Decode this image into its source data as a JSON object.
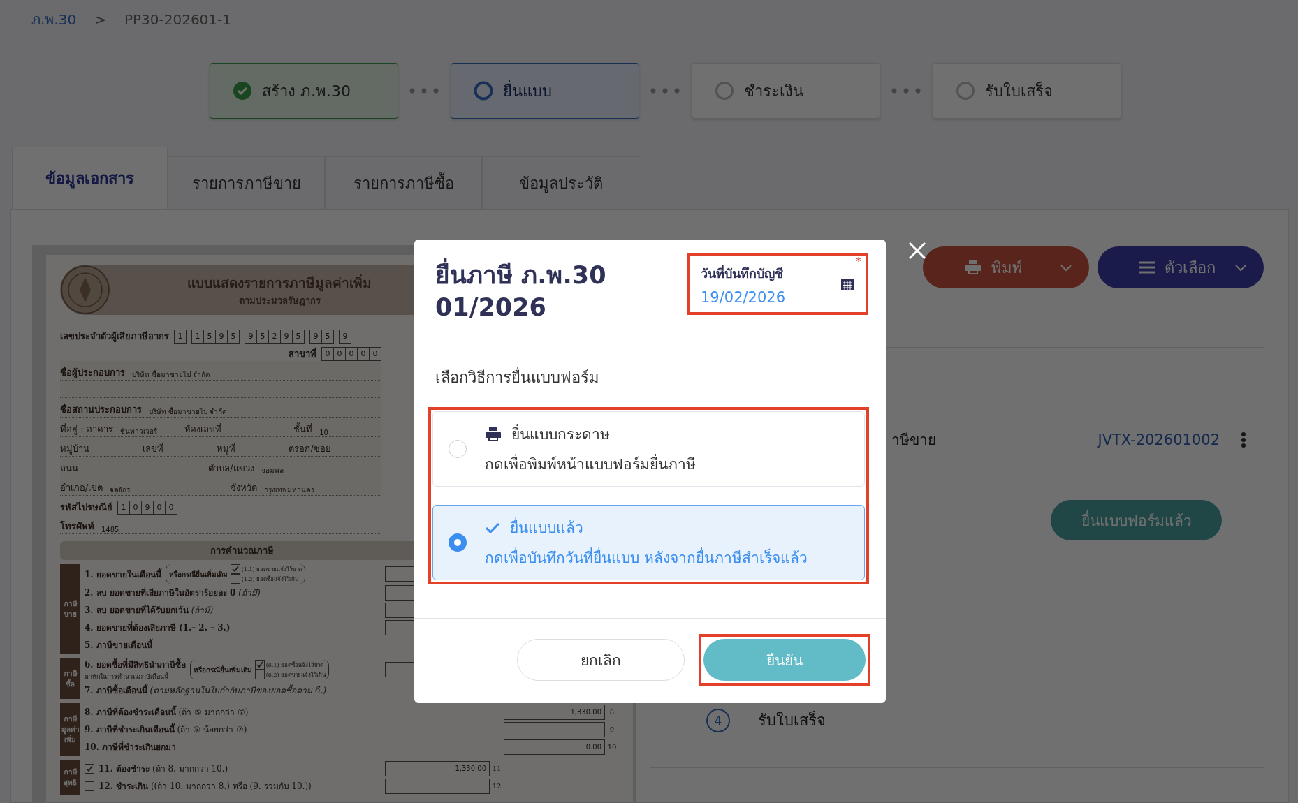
{
  "breadcrumb": [
    {
      "label": "ภ.พ.30",
      "kind": "link"
    },
    {
      "label": ">",
      "kind": "separator"
    },
    {
      "label": "PP30-202601-1",
      "kind": "current"
    }
  ],
  "steps": [
    {
      "label": "สร้าง ภ.พ.30",
      "completed": true,
      "selected": false
    },
    {
      "label": "ยื่นแบบ",
      "completed": false,
      "selected": true
    },
    {
      "label": "ชำระเงิน",
      "completed": false,
      "selected": false
    },
    {
      "label": "รับใบเสร็จ",
      "completed": false,
      "selected": false
    }
  ],
  "tabs": [
    {
      "label": "ข้อมูลเอกสาร",
      "selected": true
    },
    {
      "label": "รายการภาษีขาย",
      "selected": false
    },
    {
      "label": "รายการภาษีซื้อ",
      "selected": false
    },
    {
      "label": "ข้อมูลประวัติ",
      "selected": false
    }
  ],
  "form": {
    "title": "แบบแสดงรายการภาษีมูลค่าเพิ่ม",
    "subtitle": "ตามประมวลรัษฎากร",
    "tax_id_label": "เลขประจำตัวผู้เสียภาษีอากร",
    "tax_id_groups": [
      [
        "1"
      ],
      [
        "1",
        "5",
        "9",
        "5"
      ],
      [
        "9",
        "5",
        "2",
        "9",
        "5"
      ],
      [
        "9",
        "5"
      ],
      [
        "9"
      ]
    ],
    "branch_label": "สาขาที่",
    "branch_digits": [
      "0",
      "0",
      "0",
      "0",
      "0"
    ],
    "lines": [
      {
        "fields": [
          {
            "label": "ชื่อผู้ประกอบการ",
            "value": "บริษัท ซื้อมาขายไป จำกัด"
          }
        ],
        "continued": true
      },
      {
        "fields": [
          {
            "label": "ชื่อสถานประกอบการ",
            "value": "บริษัท ซื้อมาขายไป จำกัด"
          }
        ],
        "continued": false
      },
      {
        "fields": [
          {
            "label": "ที่อยู่ : อาคาร",
            "value": "ชินทาวเวอร์"
          },
          {
            "label": "ห้องเลขที่"
          },
          {
            "label": "ชั้นที่",
            "value": "10"
          }
        ],
        "continued": false
      },
      {
        "fields": [
          {
            "label": "หมู่บ้าน"
          },
          {
            "label": "เลขที่"
          },
          {
            "label": "หมู่ที่"
          },
          {
            "label": "ตรอก/ซอย"
          }
        ],
        "continued": false
      },
      {
        "fields": [
          {
            "label": "ถนน"
          },
          {
            "label": "ตำบล/แขวง",
            "value": "จอมพล"
          }
        ],
        "continued": false
      },
      {
        "fields": [
          {
            "label": "อำเภอ/เขต",
            "value": "จตุจักร"
          },
          {
            "label": "จังหวัด",
            "value": "กรุงเทพมหานคร"
          }
        ],
        "continued": false
      }
    ],
    "postcode_label": "รหัสไปรษณีย์",
    "postcode_digits": [
      "1",
      "0",
      "9",
      "0",
      "0"
    ],
    "phone_label": "โทรศัพท์",
    "phone_value": "1485",
    "section_title": "การคำนวณภาษี",
    "groups": [
      {
        "lines": [
          "ภาษี",
          "ขาย"
        ],
        "rows": [
          {
            "number": "1.",
            "text": "ยอดขายในเดือนนี้",
            "extra": {
              "label": "หรือกรณียื่นเพิ่มเติม",
              "options": [
                {
                  "label": "(1.1) ยอดขายแจ้งไว้ขาด",
                  "checked": true
                },
                {
                  "label": "(1.2) ยอดซื้อแจ้งไว้เกิน",
                  "checked": false
                }
              ]
            },
            "kind": "inner"
          },
          {
            "number": "2.",
            "text": "ลบ ยอดขายที่เสียภาษีในอัตราร้อยละ 0",
            "note": "(ถ้ามี)",
            "kind": "inner"
          },
          {
            "number": "3.",
            "text": "ลบ ยอดขายที่ได้รับยกเว้น",
            "note": "(ถ้ามี)",
            "kind": "inner"
          },
          {
            "number": "4.",
            "text": "ยอดขายที่ต้องเสียภาษี (1.– 2. – 3.)",
            "kind": "inner"
          },
          {
            "number": "5.",
            "text": "ภาษีขายเดือนนี้",
            "kind": "none"
          }
        ]
      },
      {
        "lines": [
          "ภาษี",
          "ซื้อ"
        ],
        "rows": [
          {
            "number": "6.",
            "text": "ยอดซื้อที่มีสิทธินำภาษีซื้อ",
            "sub": "มาหักในการคำนวณภาษีเดือนนี้",
            "extra": {
              "label": "หรือกรณียื่นเพิ่มเติม",
              "options": [
                {
                  "label": "(6.1) ยอดซื้อแจ้งไว้ขาด",
                  "checked": true
                },
                {
                  "label": "(6.2) ยอดขายแจ้งไว้เกิน",
                  "checked": false
                }
              ]
            },
            "kind": "inner"
          },
          {
            "number": "7.",
            "text": "ภาษีซื้อเดือนนี้",
            "note": "(ตามหลักฐานในใบกำกับภาษีของยอดซื้อตาม 6.)",
            "kind": "none"
          }
        ]
      },
      {
        "lines": [
          "ภาษี",
          "มูลค่า",
          "เพิ่ม"
        ],
        "rows": [
          {
            "number": "8.",
            "text": "ภาษีที่ต้องชำระเดือนนี้",
            "tail": "(ถ้า ⑤ มากกว่า ⑦)",
            "kind": "outer",
            "amount": "1,330.00",
            "line_no": "8"
          },
          {
            "number": "9.",
            "text": "ภาษีที่ชำระเกินเดือนนี้",
            "tail": "(ถ้า ⑤ น้อยกว่า ⑦)",
            "kind": "outer",
            "line_no": "9"
          },
          {
            "number": "10.",
            "text": "ภาษีที่ชำระเกินยกมา",
            "kind": "outer",
            "amount": "0.00",
            "line_no": "10"
          }
        ]
      },
      {
        "lines": [
          "ภาษี",
          "สุทธิ"
        ],
        "rows": [
          {
            "number": "11.",
            "text": "ต้องชำระ",
            "tail": "(ถ้า 8. มากกว่า 10.)",
            "checked": true,
            "kind": "inner",
            "amount": "1,330.00",
            "line_no": "11"
          },
          {
            "number": "12.",
            "text": "ชำระเกิน",
            "tail": "((ถ้า 10. มากกว่า 8.) หรือ (9. รวมกับ 10.))",
            "checked": false,
            "kind": "inner",
            "line_no": "12"
          }
        ]
      }
    ]
  },
  "actions": [
    {
      "label": "พิมพ์",
      "kind": "print"
    },
    {
      "label": "ตัวเลือก",
      "kind": "options"
    }
  ],
  "document_row": {
    "label": "าษีขาย",
    "link": "JVTX-202601002"
  },
  "filed_button": "ยื่นแบบฟอร์มแล้ว",
  "lower_step": {
    "number": "4",
    "label": "รับใบเสร็จ"
  },
  "dialog": {
    "title_lines": [
      "ยื่นภาษี ภ.พ.30",
      "01/2026"
    ],
    "date_field": {
      "label": "วันที่บันทึกบัญชี",
      "required_mark": "*",
      "value": "19/02/2026"
    },
    "method_label": "เลือกวิธีการยื่นแบบฟอร์ม",
    "options": [
      {
        "kind": "paper",
        "title": "ยื่นแบบกระดาษ",
        "description": "กดเพื่อพิมพ์หน้าแบบฟอร์มยื่นภาษี",
        "selected": false
      },
      {
        "kind": "filed",
        "title": "ยื่นแบบแล้ว",
        "description": "กดเพื่อบันทึกวันที่ยื่นแบบ หลังจากยื่นภาษีสำเร็จแล้ว",
        "selected": true
      }
    ],
    "cancel": "ยกเลิก",
    "confirm": "ยืนยัน"
  }
}
